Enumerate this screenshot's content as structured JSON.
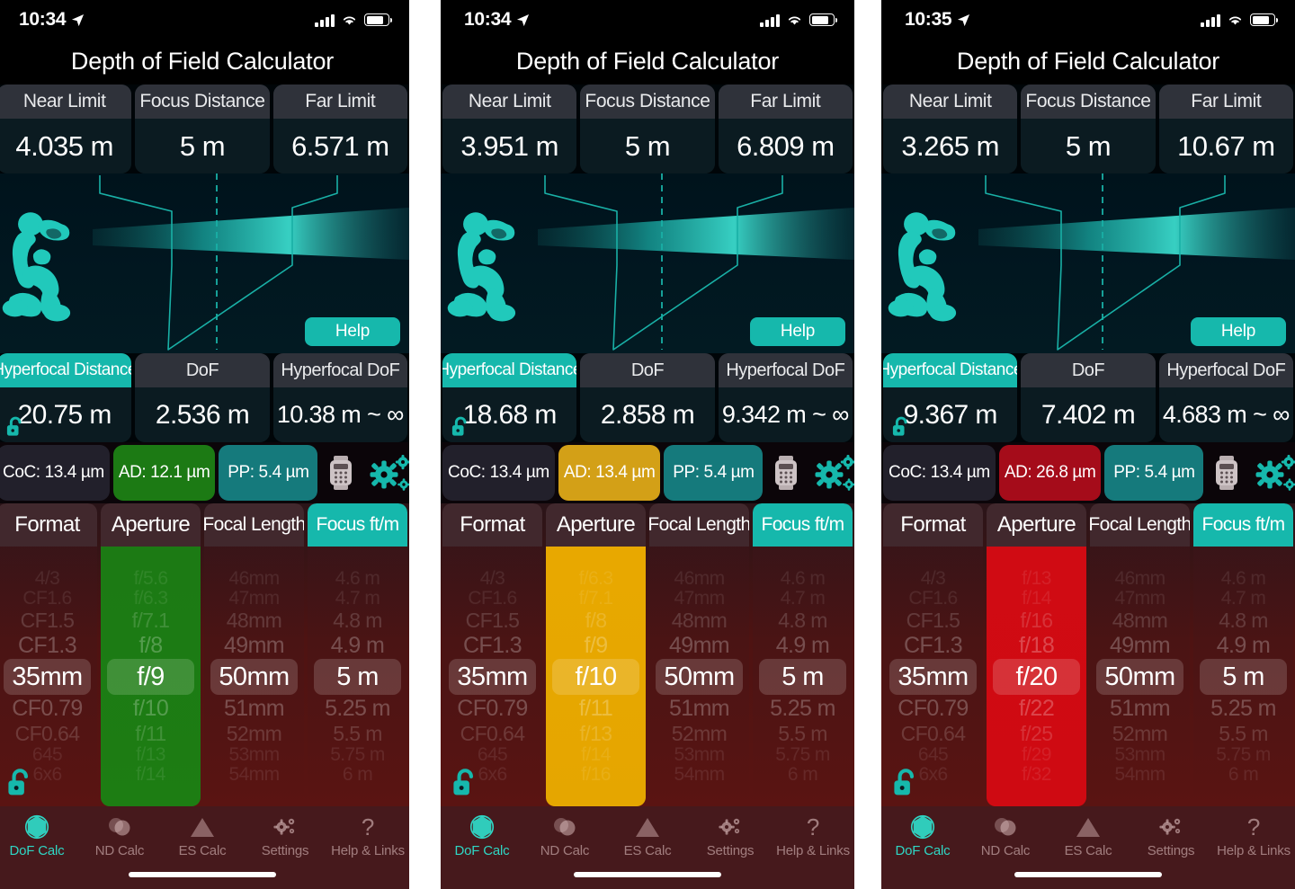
{
  "colors": {
    "teal": "#16b8ac",
    "green": "#1c7a14",
    "gold": "#e8a800",
    "red": "#d00b13",
    "card_bg": "#0b1b21",
    "header_grey": "#2f323a"
  },
  "app": {
    "title": "Depth of Field Calculator"
  },
  "tabs": [
    {
      "label": "DoF Calc",
      "icon": "aperture-icon",
      "active": true
    },
    {
      "label": "ND Calc",
      "icon": "nd-filter-icon",
      "active": false
    },
    {
      "label": "ES Calc",
      "icon": "mountain-icon",
      "active": false
    },
    {
      "label": "Settings",
      "icon": "gears-icon",
      "active": false
    },
    {
      "label": "Help & Links",
      "icon": "question-mark-icon",
      "active": false
    }
  ],
  "picker_headers": {
    "format": "Format",
    "aperture": "Aperture",
    "focal_length": "Focal Length",
    "focus": "Focus ft/m"
  },
  "help_label": "Help",
  "wheels": {
    "format": [
      "4/3",
      "CF1.6",
      "CF1.5",
      "CF1.3",
      "35mm",
      "CF0.79",
      "CF0.64",
      "645",
      "6x6"
    ],
    "focal_length": [
      "46mm",
      "47mm",
      "48mm",
      "49mm",
      "50mm",
      "51mm",
      "52mm",
      "53mm",
      "54mm"
    ],
    "focus": [
      "4.6 m",
      "4.7 m",
      "4.8 m",
      "4.9 m",
      "5 m",
      "5.25 m",
      "5.5 m",
      "5.75 m",
      "6 m"
    ]
  },
  "panels": [
    {
      "status": {
        "time": "10:34",
        "location_arrow": true
      },
      "results_top": [
        {
          "label": "Near Limit",
          "value": "4.035 m"
        },
        {
          "label": "Focus Distance",
          "value": "5 m"
        },
        {
          "label": "Far Limit",
          "value": "6.571 m"
        }
      ],
      "results_bottom": [
        {
          "label": "Hyperfocal Distance",
          "value": "20.75 m",
          "header_style": "teal",
          "locked": false
        },
        {
          "label": "DoF",
          "value": "2.536 m",
          "header_style": "grey"
        },
        {
          "label": "Hyperfocal DoF",
          "value": "10.38 m ~ ∞",
          "header_style": "grey"
        }
      ],
      "chips": [
        {
          "key": "CoC",
          "text": "CoC: 13.4 µm",
          "color": "#22202b"
        },
        {
          "key": "AD",
          "text": "AD: 12.1 µm",
          "color": "#1c7a14"
        },
        {
          "key": "PP",
          "text": "PP: 5.4 µm",
          "color": "#157a7c"
        }
      ],
      "aperture_wheel": [
        "f/5.6",
        "f/6.3",
        "f/7.1",
        "f/8",
        "f/9",
        "f/10",
        "f/11",
        "f/13",
        "f/14"
      ],
      "aperture_selected": "f/9",
      "format_selected": "35mm",
      "focal_length_selected": "50mm",
      "focus_selected": "5 m",
      "highlight": "green"
    },
    {
      "status": {
        "time": "10:34",
        "location_arrow": true
      },
      "results_top": [
        {
          "label": "Near Limit",
          "value": "3.951 m"
        },
        {
          "label": "Focus Distance",
          "value": "5 m"
        },
        {
          "label": "Far Limit",
          "value": "6.809 m"
        }
      ],
      "results_bottom": [
        {
          "label": "Hyperfocal Distance",
          "value": "18.68 m",
          "header_style": "teal",
          "locked": false
        },
        {
          "label": "DoF",
          "value": "2.858 m",
          "header_style": "grey"
        },
        {
          "label": "Hyperfocal DoF",
          "value": "9.342 m ~ ∞",
          "header_style": "grey"
        }
      ],
      "chips": [
        {
          "key": "CoC",
          "text": "CoC: 13.4 µm",
          "color": "#22202b"
        },
        {
          "key": "AD",
          "text": "AD: 13.4 µm",
          "color": "#d3a017"
        },
        {
          "key": "PP",
          "text": "PP: 5.4 µm",
          "color": "#157a7c"
        }
      ],
      "aperture_wheel": [
        "f/6.3",
        "f/7.1",
        "f/8",
        "f/9",
        "f/10",
        "f/11",
        "f/13",
        "f/14",
        "f/16"
      ],
      "aperture_selected": "f/10",
      "format_selected": "35mm",
      "focal_length_selected": "50mm",
      "focus_selected": "5 m",
      "highlight": "gold"
    },
    {
      "status": {
        "time": "10:35",
        "location_arrow": true
      },
      "results_top": [
        {
          "label": "Near Limit",
          "value": "3.265 m"
        },
        {
          "label": "Focus Distance",
          "value": "5 m"
        },
        {
          "label": "Far Limit",
          "value": "10.67 m"
        }
      ],
      "results_bottom": [
        {
          "label": "Hyperfocal Distance",
          "value": "9.367 m",
          "header_style": "teal",
          "locked": false
        },
        {
          "label": "DoF",
          "value": "7.402 m",
          "header_style": "grey"
        },
        {
          "label": "Hyperfocal DoF",
          "value": "4.683 m ~ ∞",
          "header_style": "grey"
        }
      ],
      "chips": [
        {
          "key": "CoC",
          "text": "CoC: 13.4 µm",
          "color": "#22202b"
        },
        {
          "key": "AD",
          "text": "AD: 26.8 µm",
          "color": "#a50c1a"
        },
        {
          "key": "PP",
          "text": "PP: 5.4 µm",
          "color": "#157a7c"
        }
      ],
      "aperture_wheel": [
        "f/13",
        "f/14",
        "f/16",
        "f/18",
        "f/20",
        "f/22",
        "f/25",
        "f/29",
        "f/32"
      ],
      "aperture_selected": "f/20",
      "format_selected": "35mm",
      "focal_length_selected": "50mm",
      "focus_selected": "5 m",
      "highlight": "red"
    }
  ]
}
